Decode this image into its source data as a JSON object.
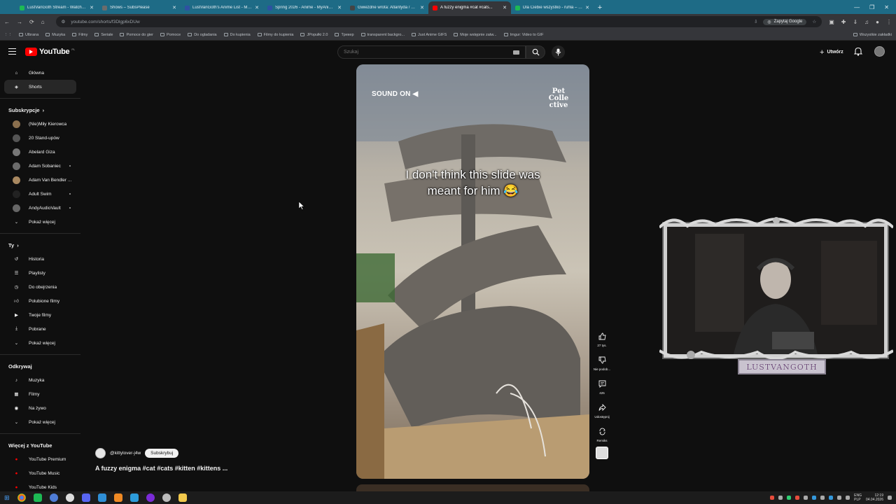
{
  "browser": {
    "tabs": [
      {
        "title": "LustVanGoth Stream - Watch Li...",
        "fav_color": "#1db954",
        "active": false
      },
      {
        "title": "Shows – SubsPlease",
        "fav_color": "#6c6c6c",
        "active": false
      },
      {
        "title": "LustVanGoth's Anime List - My...",
        "fav_color": "#2e51a2",
        "active": false
      },
      {
        "title": "Spring 2026 - Anime - MyAnim...",
        "fav_color": "#2e51a2",
        "active": false
      },
      {
        "title": "Gwiezdne wrota: Atlantyda / St...",
        "fav_color": "#444444",
        "active": false
      },
      {
        "title": "A fuzzy enigma #cat #cats...",
        "fav_color": "#ff0000",
        "active": true
      },
      {
        "title": "Dla Ciebie wszystko - ruhla – w...",
        "fav_color": "#1db954",
        "active": false
      }
    ],
    "url": "youtube.com/shorts/f3Dlgp6xDUw",
    "google_search_label": "Zapytaj Google",
    "bookmarks": [
      "Ulbrana",
      "Muzyka",
      "Filmy",
      "Seriale",
      "Pomoce do gier",
      "Pomoce",
      "Do ogladania",
      "Do kupienia",
      "Filmy do kupienia",
      "JPopułki 2.0",
      "Tрекер",
      "transparent backgro...",
      "Just Anime GIFS",
      "Moje wstępnie zatw...",
      "Imgur: Video to GIF"
    ],
    "all_bookmarks": "Wszystkie zakładki"
  },
  "youtube": {
    "logo_text": "YouTube",
    "logo_country": "PL",
    "search_placeholder": "Szukaj",
    "create_label": "Utwórz"
  },
  "sidebar": {
    "main": [
      {
        "label": "Główna",
        "icon": "home-icon",
        "active": false
      },
      {
        "label": "Shorts",
        "icon": "shorts-icon",
        "active": true
      }
    ],
    "subs_header": "Subskrypcje",
    "subs": [
      {
        "label": "(Nie)Miły Kierowca",
        "color": "#8a6f4e",
        "dot": false
      },
      {
        "label": "20 Stand-upów",
        "color": "#555555",
        "dot": false
      },
      {
        "label": "Abelard Giza",
        "color": "#777777",
        "dot": false
      },
      {
        "label": "Adam Sobaniec",
        "color": "#6b6b6b",
        "dot": true
      },
      {
        "label": "Adam Van Bendler ...",
        "color": "#a88860",
        "dot": false
      },
      {
        "label": "Adult Swim",
        "color": "#222222",
        "dot": true
      },
      {
        "label": "AndyAudioVault",
        "color": "#666666",
        "dot": true
      }
    ],
    "show_more": "Pokaż więcej",
    "you_header": "Ty",
    "you": [
      {
        "label": "Historia",
        "icon": "history-icon"
      },
      {
        "label": "Playlisty",
        "icon": "playlists-icon"
      },
      {
        "label": "Do obejrzenia",
        "icon": "watch-later-icon"
      },
      {
        "label": "Polubione filmy",
        "icon": "liked-icon"
      },
      {
        "label": "Twoje filmy",
        "icon": "your-videos-icon"
      },
      {
        "label": "Pobrane",
        "icon": "download-icon"
      },
      {
        "label": "Pokaż więcej",
        "icon": "chevron-down-icon"
      }
    ],
    "explore_header": "Odkrywaj",
    "explore": [
      {
        "label": "Muzyka",
        "icon": "music-icon"
      },
      {
        "label": "Filmy",
        "icon": "film-icon"
      },
      {
        "label": "Na żywo",
        "icon": "live-icon"
      },
      {
        "label": "Pokaż więcej",
        "icon": "chevron-down-icon"
      }
    ],
    "more_header": "Więcej z YouTube",
    "more": [
      {
        "label": "YouTube Premium",
        "icon": "yt-premium-icon"
      },
      {
        "label": "YouTube Music",
        "icon": "yt-music-icon"
      },
      {
        "label": "YouTube Kids",
        "icon": "yt-kids-icon"
      }
    ]
  },
  "short": {
    "sound_on": "SOUND ON",
    "pet_logo": "Pet Colle ctive",
    "caption_line1": "I don't think this slide was",
    "caption_line2": "meant for him 😂",
    "channel": "@kittylover-j4w",
    "subscribe": "Subskrybuj",
    "title": "A fuzzy enigma #cat #cats #kitten #kittens ...",
    "likes": "27 tys.",
    "dislike_label": "Nie podob...",
    "comments": "425",
    "share_label": "Udostępnij",
    "remix_label": "Remiks"
  },
  "webcam": {
    "name": "LUSTVANGOTH"
  },
  "taskbar": {
    "lang_top": "ENG",
    "lang_bottom": "PLP",
    "time": "12:19",
    "date": "04.04.2026"
  }
}
